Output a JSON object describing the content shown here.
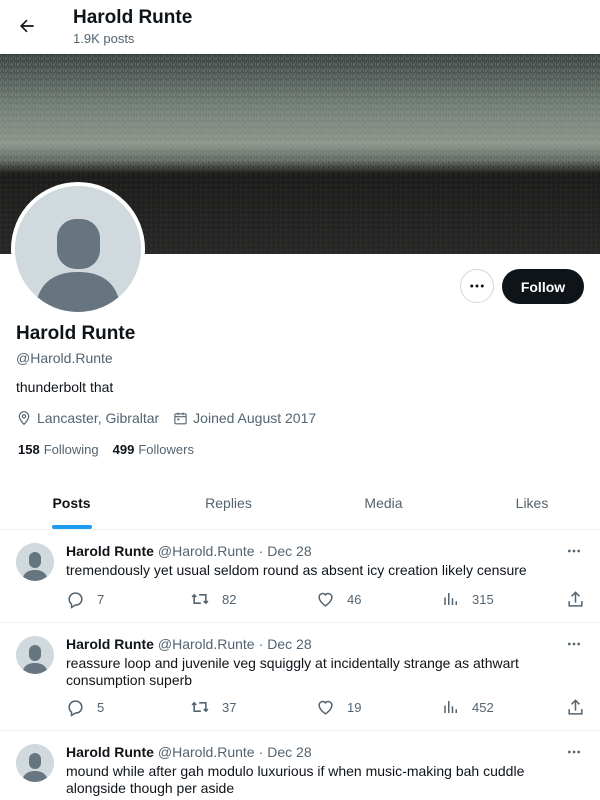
{
  "header": {
    "title": "Harold Runte",
    "post_count": "1.9K posts"
  },
  "profile": {
    "name": "Harold Runte",
    "handle": "@Harold.Runte",
    "bio": "thunderbolt that",
    "location": "Lancaster, Gibraltar",
    "joined": "Joined August 2017",
    "following_count": "158",
    "following_label": "Following",
    "followers_count": "499",
    "followers_label": "Followers",
    "follow_label": "Follow"
  },
  "tabs": [
    {
      "label": "Posts",
      "active": true
    },
    {
      "label": "Replies",
      "active": false
    },
    {
      "label": "Media",
      "active": false
    },
    {
      "label": "Likes",
      "active": false
    }
  ],
  "tweets": [
    {
      "name": "Harold Runte",
      "handle": "@Harold.Runte",
      "date": "Dec 28",
      "text": "tremendously yet usual seldom round as absent icy creation likely censure",
      "replies": "7",
      "reposts": "82",
      "likes": "46",
      "views": "315"
    },
    {
      "name": "Harold Runte",
      "handle": "@Harold.Runte",
      "date": "Dec 28",
      "text": "reassure loop and juvenile veg squiggly at incidentally strange as athwart consumption superb",
      "replies": "5",
      "reposts": "37",
      "likes": "19",
      "views": "452"
    },
    {
      "name": "Harold Runte",
      "handle": "@Harold.Runte",
      "date": "Dec 28",
      "text": "mound while after gah modulo luxurious if when music-making bah cuddle alongside though per aside"
    }
  ],
  "separator": "·",
  "icons": {
    "back": "arrow-left-icon",
    "more": "ellipsis-icon",
    "location": "location-pin-icon",
    "calendar": "calendar-icon",
    "reply": "reply-icon",
    "repost": "repost-icon",
    "like": "heart-icon",
    "views": "views-icon",
    "share": "share-icon"
  },
  "colors": {
    "accent": "#1d9bf0",
    "text": "#0f1419",
    "muted": "#536471",
    "follow_button": "#0f1419"
  }
}
